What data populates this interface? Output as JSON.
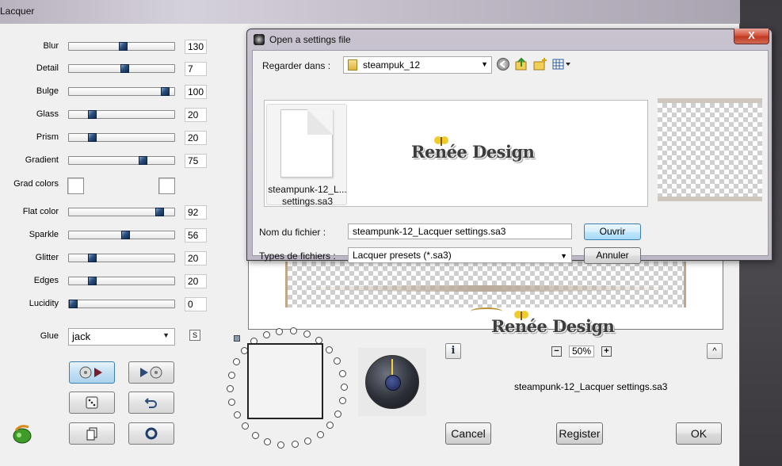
{
  "main_window": {
    "title": "Lacquer",
    "sliders": [
      {
        "label": "Blur",
        "value": "130",
        "fraction": 0.52
      },
      {
        "label": "Detail",
        "value": "7",
        "fraction": 0.53
      },
      {
        "label": "Bulge",
        "value": "100",
        "fraction": 0.95
      },
      {
        "label": "Glass",
        "value": "20",
        "fraction": 0.2
      },
      {
        "label": "Prism",
        "value": "20",
        "fraction": 0.2
      },
      {
        "label": "Gradient",
        "value": "75",
        "fraction": 0.72
      },
      {
        "label": "Flat color",
        "value": "92",
        "fraction": 0.89
      },
      {
        "label": "Sparkle",
        "value": "56",
        "fraction": 0.54
      },
      {
        "label": "Glitter",
        "value": "20",
        "fraction": 0.2
      },
      {
        "label": "Edges",
        "value": "20",
        "fraction": 0.2
      },
      {
        "label": "Lucidity",
        "value": "0",
        "fraction": 0.0
      }
    ],
    "grad_colors_label": "Grad colors",
    "glue_label": "Glue",
    "glue_value": "jack",
    "s_icon": "S",
    "zoom_value": "50%",
    "zoom_minus": "−",
    "zoom_plus": "+",
    "info_icon": "i",
    "up_icon": "^",
    "bottom_filename": "steampunk-12_Lacquer settings.sa3",
    "buttons": {
      "cancel": "Cancel",
      "register": "Register",
      "ok": "OK"
    },
    "watermark_logo": "Renée Design"
  },
  "dialog": {
    "title": "Open a settings file",
    "close_icon": "X",
    "look_in_label": "Regarder dans :",
    "look_in_value": "steampuk_12",
    "file_item_name_line1": "steampunk-12_L...",
    "file_item_name_line2": "settings.sa3",
    "watermark_logo": "Renée Design",
    "filename_label": "Nom du fichier :",
    "filename_value": "steampunk-12_Lacquer settings.sa3",
    "filetype_label": "Types de fichiers :",
    "filetype_value": "Lacquer presets (*.sa3)",
    "open_button": "Ouvrir",
    "cancel_button": "Annuler"
  },
  "icons": {
    "app_logo": "green-leaf-logo-icon",
    "nav_back": "back-arrow-icon",
    "nav_up": "up-folder-icon",
    "new_folder": "new-folder-icon",
    "view_menu": "view-menu-icon"
  }
}
